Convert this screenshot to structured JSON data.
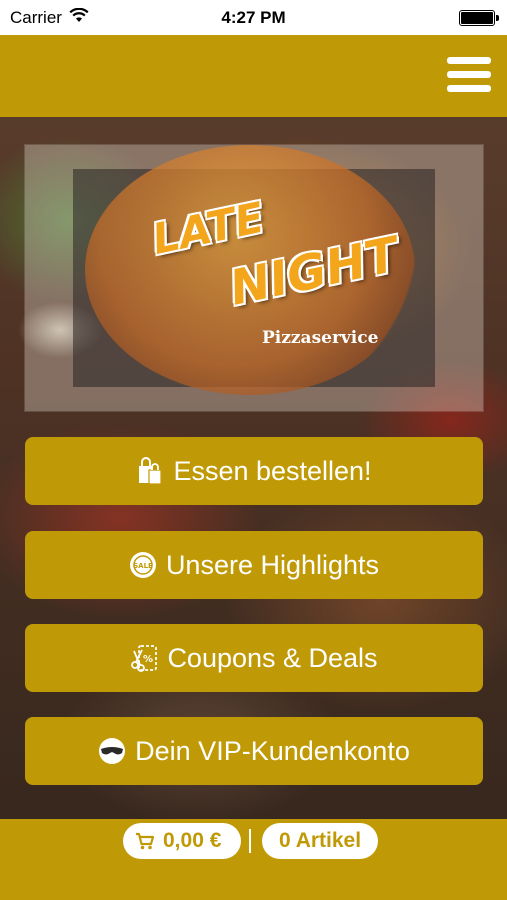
{
  "status_bar": {
    "carrier": "Carrier",
    "time": "4:27 PM"
  },
  "header": {
    "menu_icon": "hamburger-menu-icon"
  },
  "logo": {
    "line1": "LATE",
    "line2": "NIGHT",
    "subtitle": "Pizzaservice"
  },
  "buttons": [
    {
      "label": "Essen bestellen!",
      "icon": "shopping-bags-icon"
    },
    {
      "label": "Unsere Highlights",
      "icon": "sale-badge-icon"
    },
    {
      "label": "Coupons & Deals",
      "icon": "coupon-scissors-icon"
    },
    {
      "label": "Dein VIP-Kundenkonto",
      "icon": "vip-mask-icon"
    }
  ],
  "cart": {
    "price": "0,00 €",
    "separator": "|",
    "items": "0 Artikel"
  },
  "colors": {
    "accent": "#c09a06",
    "text_on_accent": "#ffffff"
  }
}
